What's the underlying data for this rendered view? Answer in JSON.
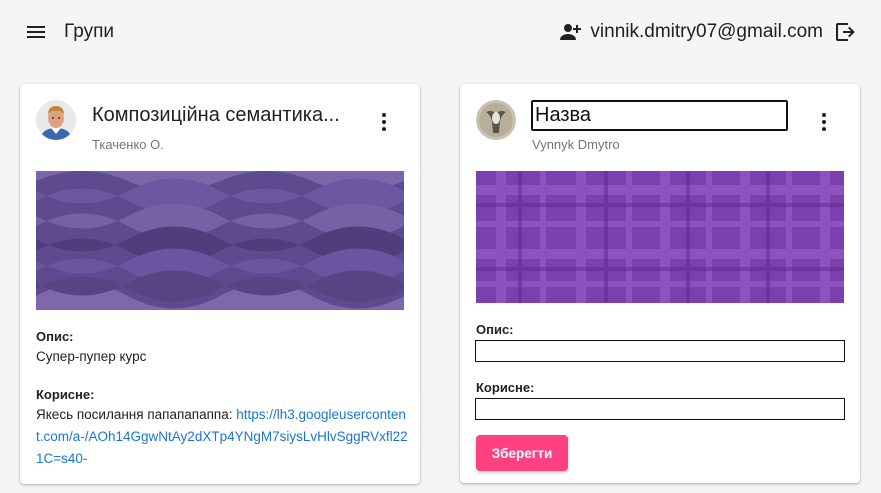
{
  "header": {
    "title": "Групи",
    "user_email": "vinnik.dmitry07@gmail.com",
    "menu_icon": "menu-icon",
    "user_add_icon": "person-add-icon",
    "logout_icon": "logout-icon"
  },
  "cards": [
    {
      "title": "Композиційна семантика...",
      "subtitle": "Ткаченко О.",
      "description_label": "Опис:",
      "description": "Супер-пупер курс",
      "useful_label": "Корисне:",
      "useful_text": "Якесь посилання папапапаппа: ",
      "useful_link": "https://lh3.googleusercontent.com/a-/AOh14GgwNtAy2dXTp4YNgM7siysLvHlvSggRVxfl221C=s40-",
      "image_color": "#5e4a8e"
    },
    {
      "title_value": "Назва",
      "subtitle": "Vynnyk Dmytro",
      "description_label": "Опис:",
      "useful_label": "Корисне:",
      "save_label": "Зберегти",
      "image_color": "#7b3fb0"
    }
  ],
  "colors": {
    "accent": "#ff4081",
    "link": "#1976d2",
    "background": "#f5f5f5"
  }
}
